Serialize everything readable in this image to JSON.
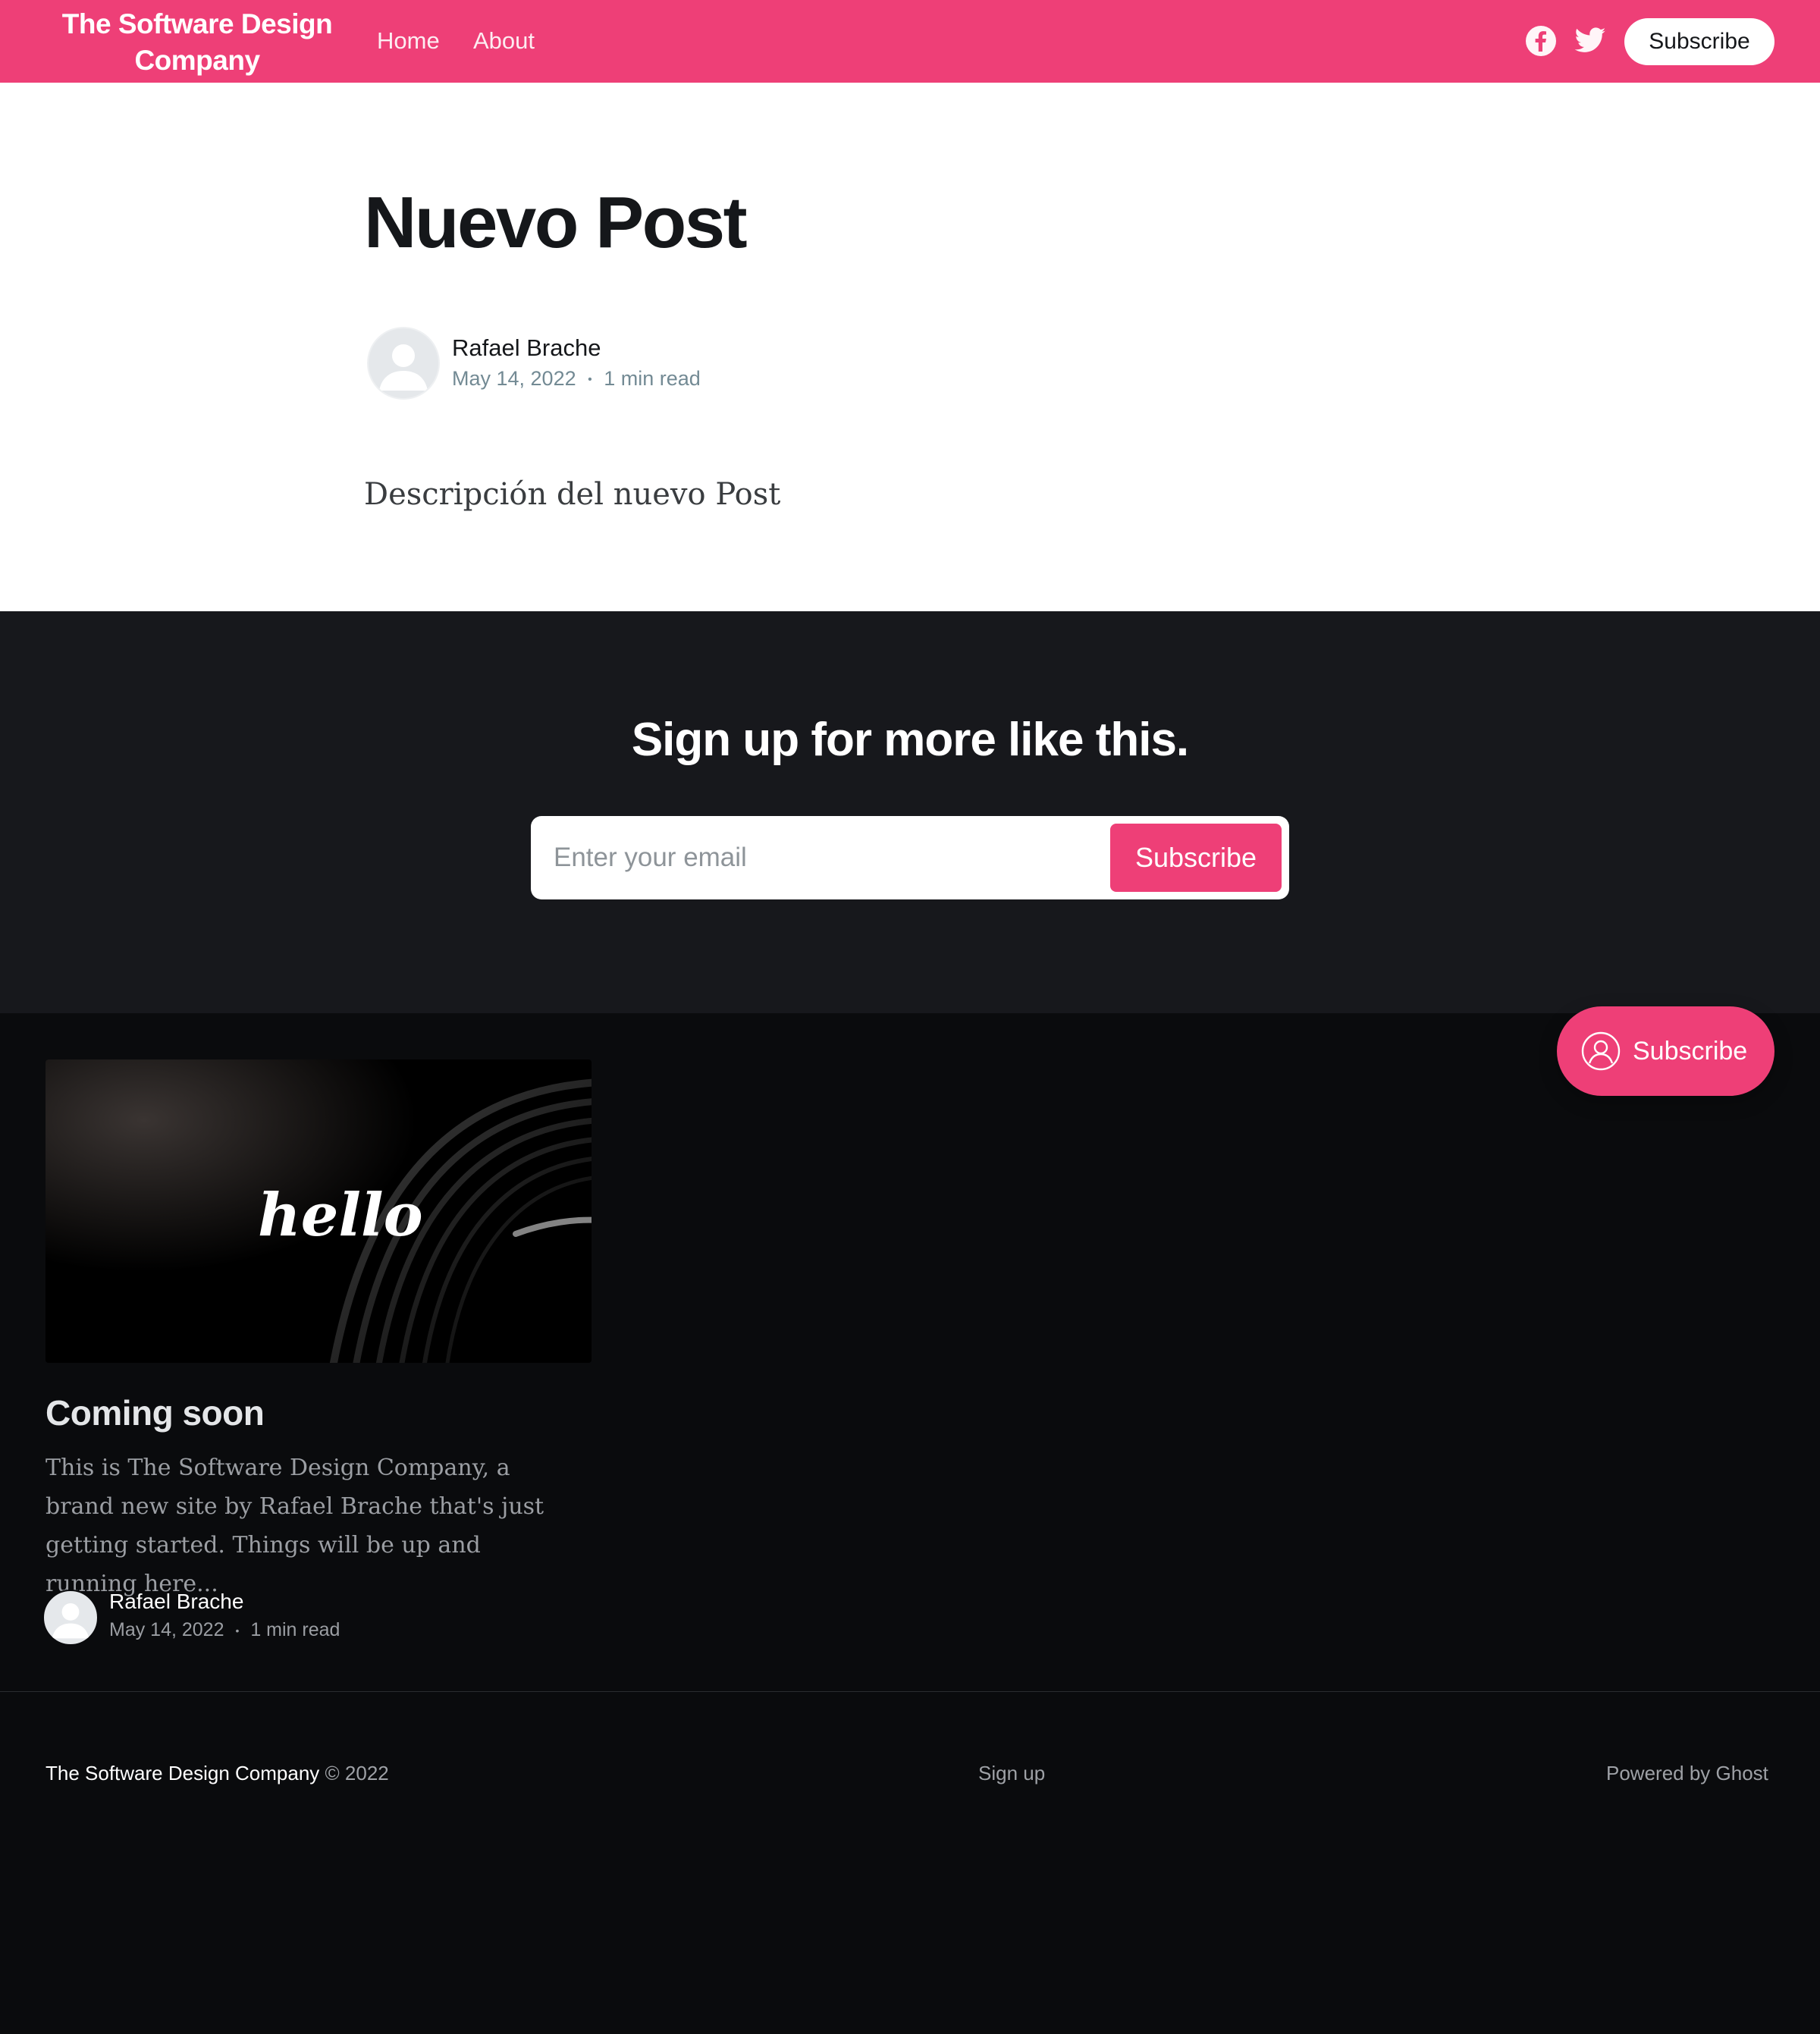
{
  "header": {
    "brand": "The Software Design Company",
    "nav": [
      "Home",
      "About"
    ],
    "social_icons": [
      "facebook-icon",
      "twitter-icon"
    ],
    "subscribe_label": "Subscribe"
  },
  "post": {
    "title": "Nuevo Post",
    "author": "Rafael Brache",
    "date": "May 14, 2022",
    "separator": "•",
    "read_time": "1 min read",
    "body": "Descripción del nuevo Post"
  },
  "cta": {
    "title": "Sign up for more like this.",
    "email_placeholder": "Enter your email",
    "button_label": "Subscribe"
  },
  "portal": {
    "label": "Subscribe",
    "icon": "user-circle-icon"
  },
  "card": {
    "image_text": "hello",
    "title": "Coming soon",
    "excerpt": "This is The Software Design Company, a brand new site by Rafael Brache that's just getting started. Things will be up and running here...",
    "author": "Rafael Brache",
    "date": "May 14, 2022",
    "separator": "•",
    "read_time": "1 min read"
  },
  "footer": {
    "site_name": "The Software Design Company",
    "copyright": "© 2022",
    "signup_label": "Sign up",
    "powered_by": "Powered by Ghost"
  },
  "colors": {
    "accent": "#ee3f77",
    "cta_background": "#17181c",
    "page_background": "#0a0b0d"
  }
}
